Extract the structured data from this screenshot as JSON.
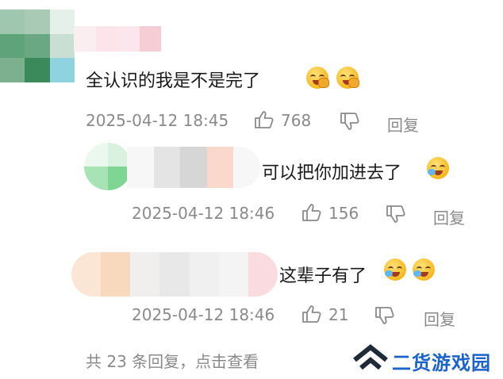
{
  "comments": [
    {
      "text": "全认识的我是不是完了",
      "time": "2025-04-12 18:45",
      "likes": "768",
      "reply_label": "回复",
      "emojis": [
        "laughing-tears-icon",
        "laughing-tears-icon"
      ]
    }
  ],
  "replies": [
    {
      "text": "可以把你加进去了",
      "time": "2025-04-12 18:46",
      "likes": "156",
      "reply_label": "回复",
      "emojis": [
        "crying-laughing-icon"
      ]
    },
    {
      "text": "这辈子有了",
      "time": "2025-04-12 18:46",
      "likes": "21",
      "reply_label": "回复",
      "emojis": [
        "crying-laughing-icon",
        "crying-laughing-icon"
      ]
    }
  ],
  "footer": {
    "more_replies": "共 23 条回复，点击查看"
  },
  "watermark": {
    "brand": "二货游戏园",
    "logo_icon": "double-chevron-up-icon"
  },
  "colors": {
    "text": "#1a1a1a",
    "meta": "#8a8a8a",
    "brand": "#1c63c9",
    "emoji": "#f5b820"
  }
}
